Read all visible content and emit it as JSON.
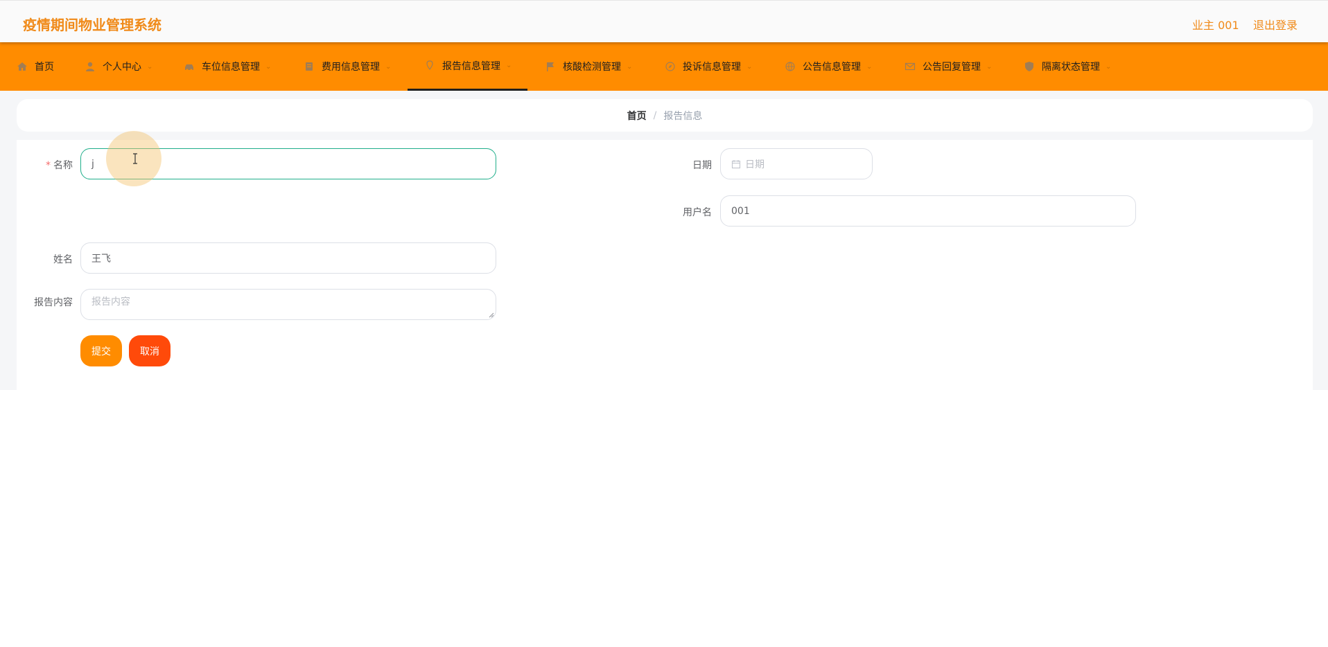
{
  "header": {
    "app_title": "疫情期间物业管理系统",
    "user": "业主 001",
    "logout": "退出登录"
  },
  "nav": {
    "items": [
      {
        "label": "首页",
        "icon": "home-icon"
      },
      {
        "label": "个人中心",
        "icon": "user-icon"
      },
      {
        "label": "车位信息管理",
        "icon": "car-icon"
      },
      {
        "label": "费用信息管理",
        "icon": "document-icon"
      },
      {
        "label": "报告信息管理",
        "icon": "pin-icon",
        "active": true
      },
      {
        "label": "核酸检测管理",
        "icon": "flag-icon"
      },
      {
        "label": "投诉信息管理",
        "icon": "compass-icon"
      },
      {
        "label": "公告信息管理",
        "icon": "globe-icon"
      },
      {
        "label": "公告回复管理",
        "icon": "mail-icon"
      },
      {
        "label": "隔离状态管理",
        "icon": "shield-icon"
      }
    ]
  },
  "breadcrumb": {
    "home": "首页",
    "separator": "/",
    "current": "报告信息"
  },
  "form": {
    "name_label": "名称",
    "name_value": "j",
    "date_label": "日期",
    "date_placeholder": "日期",
    "username_label": "用户名",
    "username_value": "001",
    "realname_label": "姓名",
    "realname_value": "王飞",
    "content_label": "报告内容",
    "content_placeholder": "报告内容",
    "submit_label": "提交",
    "cancel_label": "取消"
  },
  "colors": {
    "accent": "#ff8c00",
    "title": "#f08a19",
    "submit": "#ff8c00",
    "cancel": "#ff4a0a",
    "focus_border": "#1fae8a"
  }
}
